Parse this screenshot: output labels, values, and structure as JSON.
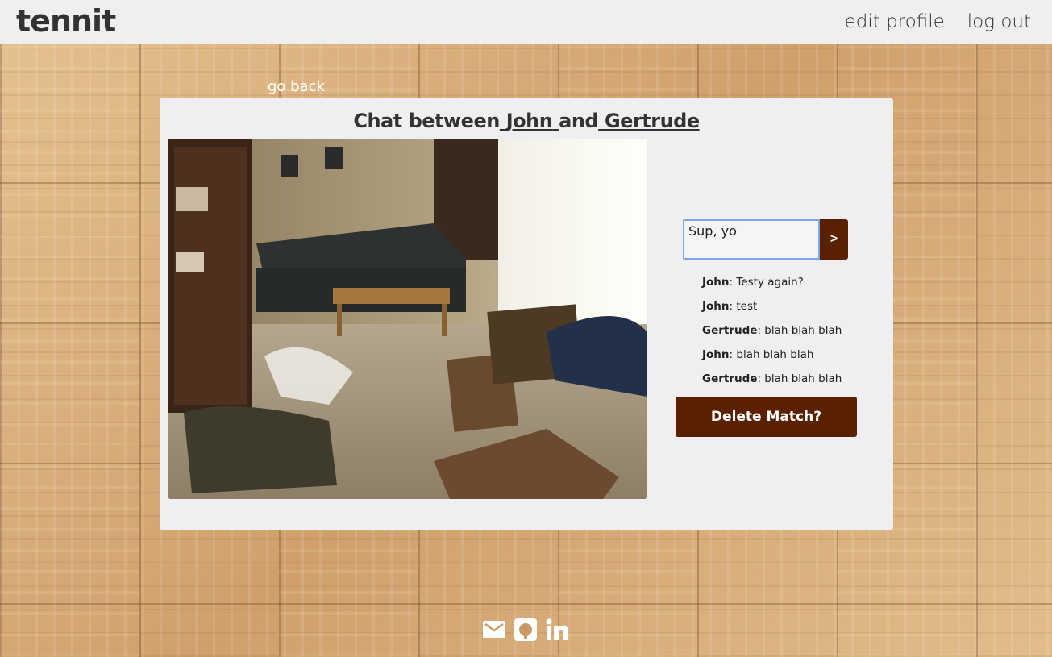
{
  "navbar": {
    "brand": "tennit",
    "links": [
      "edit profile",
      "log out"
    ]
  },
  "go_back_label": "go back",
  "chat": {
    "title_prefix": "Chat between",
    "user_a": "John",
    "conjunction": "and",
    "user_b": "Gertrude"
  },
  "message_form": {
    "input_value": "Sup, yo",
    "send_label": ">"
  },
  "messages": [
    {
      "author": "John",
      "text": ": Testy again?"
    },
    {
      "author": "John",
      "text": ": test"
    },
    {
      "author": "Gertrude",
      "text": ": blah blah blah"
    },
    {
      "author": "John",
      "text": ": blah blah blah"
    },
    {
      "author": "Gertrude",
      "text": ": blah blah blah"
    }
  ],
  "delete_label": "Delete Match?",
  "footer_icons": [
    "envelope-icon",
    "github-icon",
    "linkedin-icon"
  ],
  "colors": {
    "accent": "#5a2000",
    "card_bg": "#efeff2",
    "navbar_bg": "#efeff2",
    "input_border": "#7ea7e8"
  }
}
